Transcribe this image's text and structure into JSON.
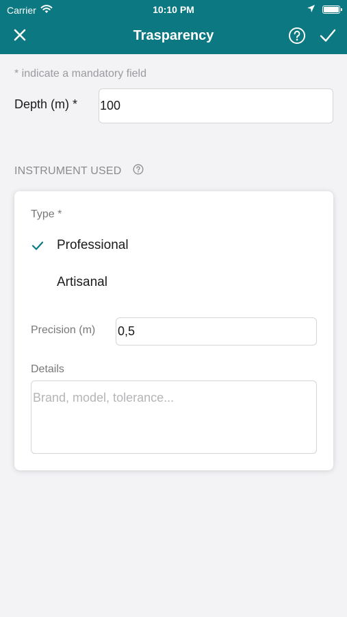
{
  "status_bar": {
    "carrier": "Carrier",
    "time": "10:10 PM",
    "wifi_icon": "wifi-icon",
    "location_icon": "location-arrow-icon",
    "battery_icon": "battery-icon",
    "battery_level": 1.0
  },
  "nav": {
    "title": "Trasparency",
    "close_icon": "close-icon",
    "help_icon": "help-circle-icon",
    "confirm_icon": "checkmark-icon"
  },
  "form": {
    "mandatory_note": "* indicate a mandatory field",
    "depth_label": "Depth (m) *",
    "depth_value": "100"
  },
  "instrument": {
    "section_title": "INSTRUMENT USED",
    "help_icon": "help-circle-icon",
    "type_label": "Type *",
    "options": [
      {
        "label": "Professional",
        "selected": true
      },
      {
        "label": "Artisanal",
        "selected": false
      }
    ],
    "precision_label": "Precision (m)",
    "precision_value": "0,5",
    "details_label": "Details",
    "details_placeholder": "Brand, model, tolerance..."
  },
  "colors": {
    "brand": "#0b7882",
    "background": "#f3f3f6",
    "muted_text": "#8a8a8f"
  }
}
